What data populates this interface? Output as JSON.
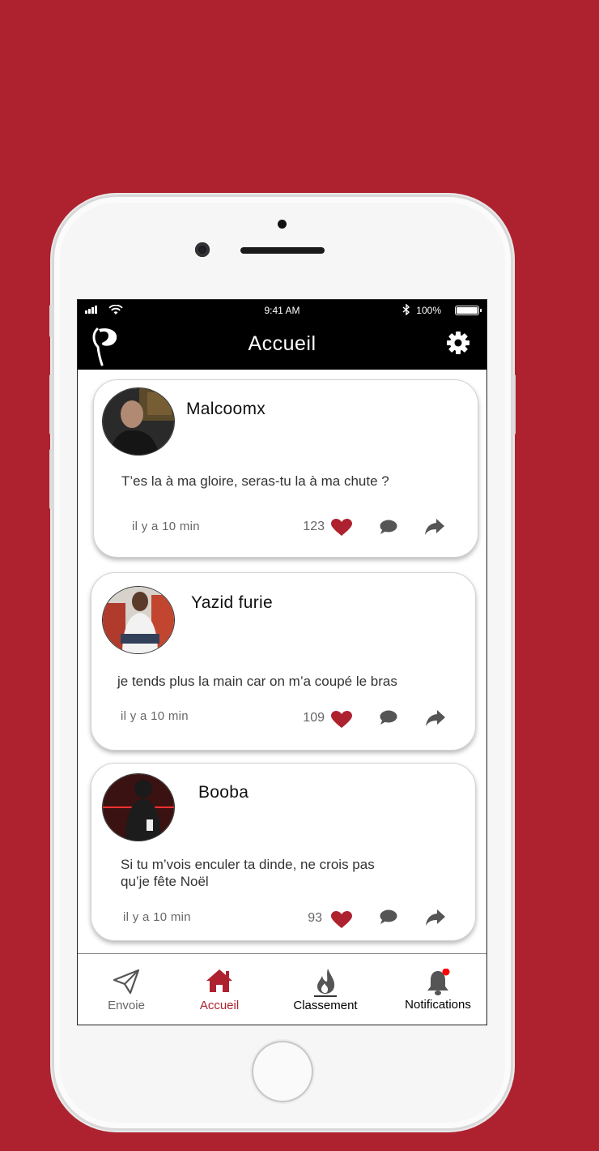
{
  "status_bar": {
    "time": "9:41 AM",
    "battery": "100%",
    "bluetooth_icon": "bluetooth-icon"
  },
  "header": {
    "title": "Accueil",
    "logo_icon": "leaf-p-logo",
    "settings_icon": "gear-icon"
  },
  "colors": {
    "accent": "#ae2230",
    "header_bg": "#000000",
    "background": "#ae2230"
  },
  "posts": [
    {
      "author": "Malcoomx",
      "text": "T’es la à ma gloire, seras-tu la à ma chute ?",
      "time": "il y a 10 min",
      "likes": "123"
    },
    {
      "author": "Yazid furie",
      "text": "je tends plus la main car on m’a coupé le bras",
      "time": "il y a 10 min",
      "likes": "109"
    },
    {
      "author": "Booba",
      "text_line1": "Si tu m’vois enculer ta dinde, ne crois pas",
      "text_line2": "qu’je fête Noël",
      "time": "il y a 10 min",
      "likes": "93"
    }
  ],
  "tabs": [
    {
      "label": "Envoie",
      "icon": "paper-plane-icon"
    },
    {
      "label": "Accueil",
      "icon": "home-icon",
      "active": true
    },
    {
      "label": "Classement",
      "icon": "flame-icon"
    },
    {
      "label": "Notifications",
      "icon": "bell-icon"
    }
  ]
}
